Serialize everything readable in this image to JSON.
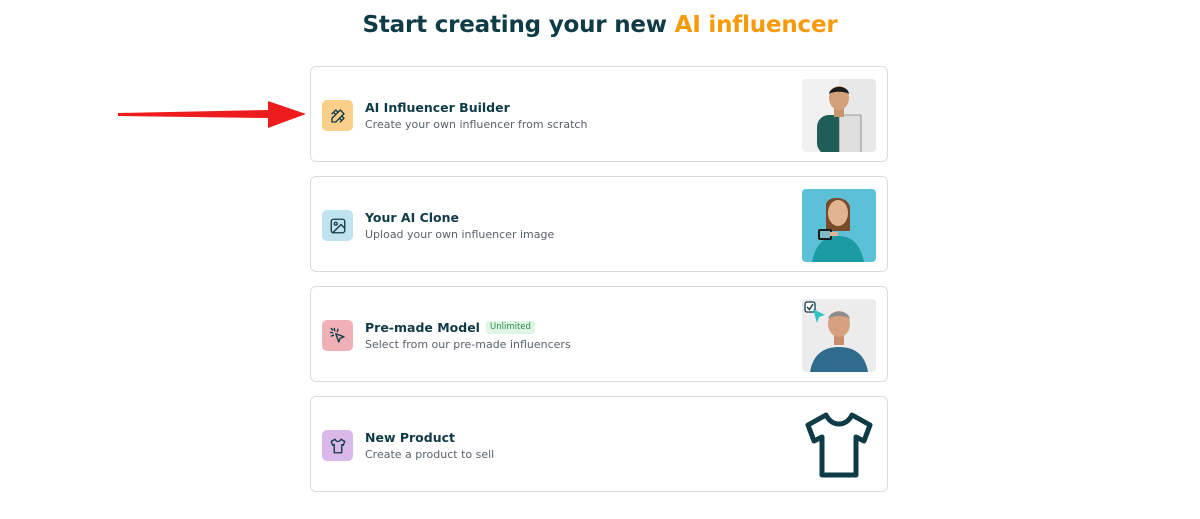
{
  "header": {
    "title_prefix": "Start creating your new",
    "title_accent": "AI influencer"
  },
  "cards": [
    {
      "label": "AI Influencer Builder",
      "description": "Create your own influencer from scratch",
      "icon": "pencil-ruler-icon",
      "icon_bg": "#f9cf8a"
    },
    {
      "label": "Your AI Clone",
      "description": "Upload your own influencer image",
      "icon": "image-upload-icon",
      "icon_bg": "#bfe3ef"
    },
    {
      "label": "Pre-made Model",
      "badge": "Unlimited",
      "description": "Select from our pre-made influencers",
      "icon": "cursor-click-icon",
      "icon_bg": "#efb1b5"
    },
    {
      "label": "New Product",
      "description": "Create a product to sell",
      "icon": "shirt-icon",
      "icon_bg": "#dbb8ea"
    }
  ],
  "colors": {
    "title": "#0f3b47",
    "accent": "#f59a0b",
    "arrow": "#ee1c1c"
  }
}
